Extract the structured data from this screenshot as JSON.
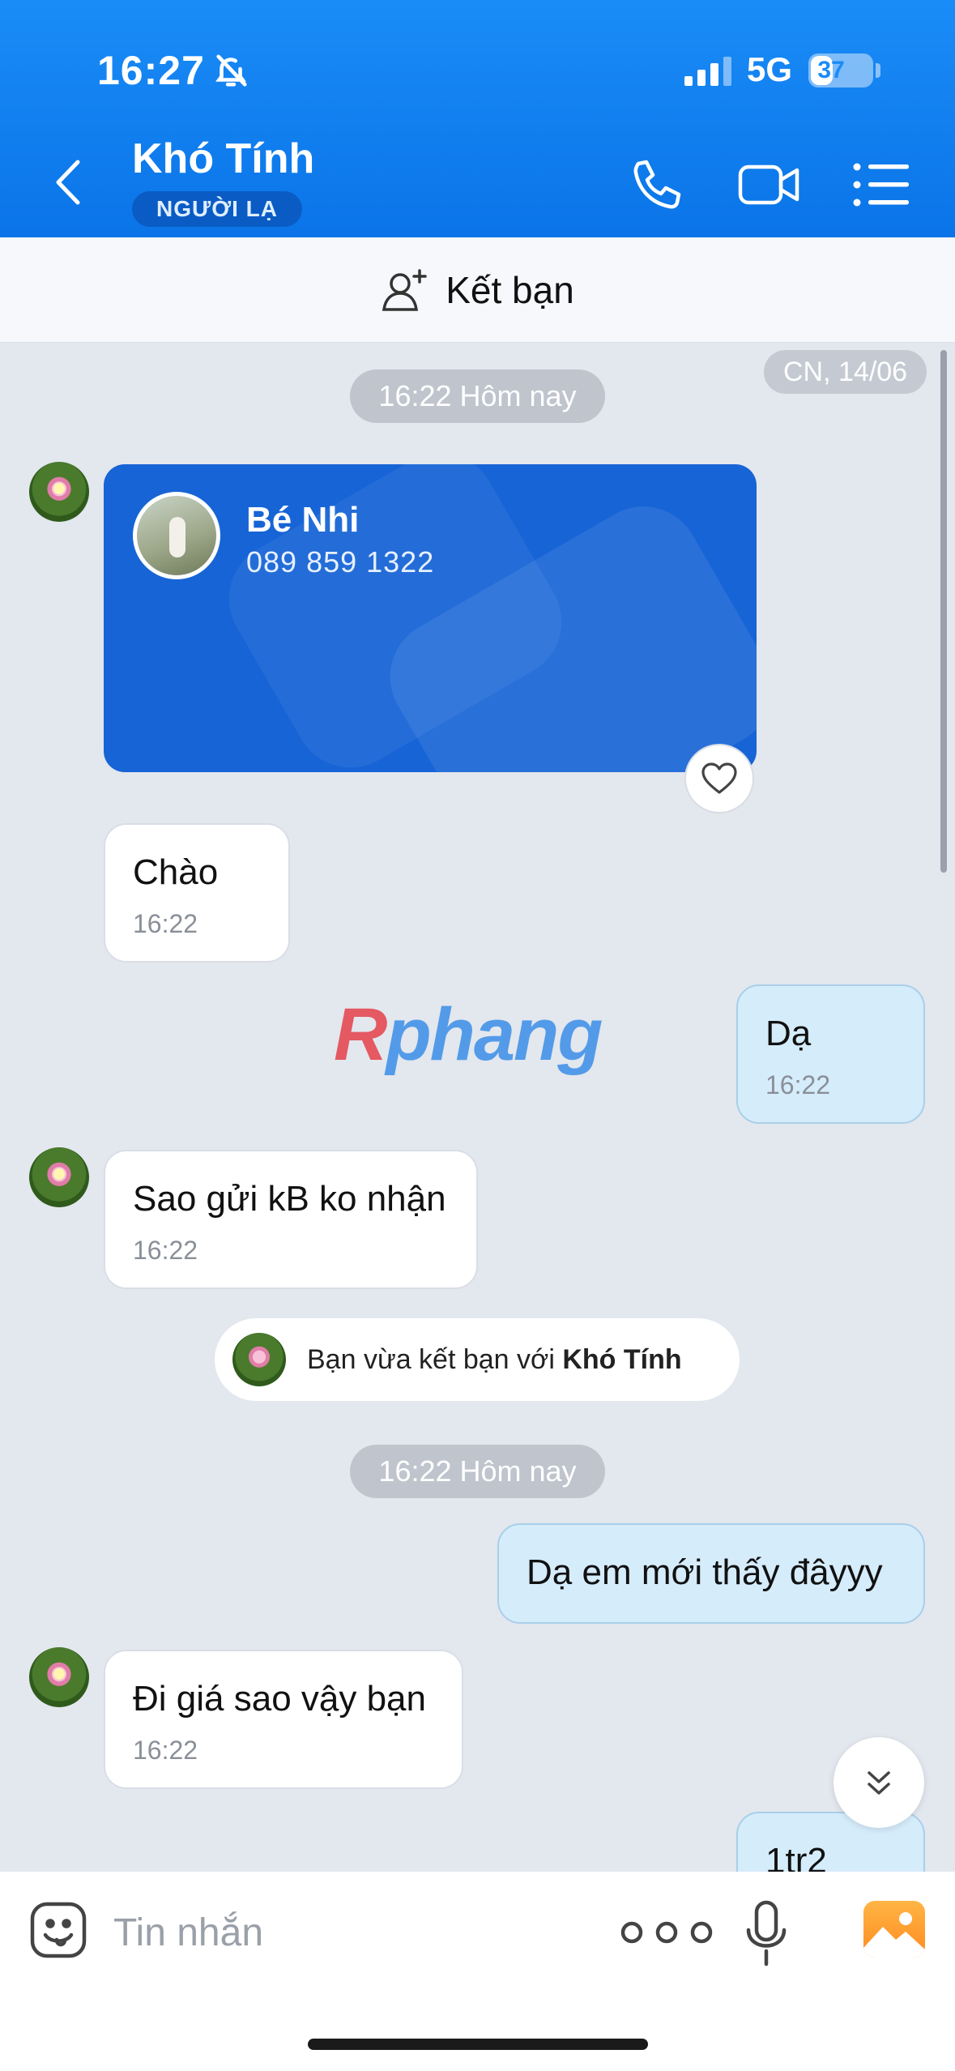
{
  "status_bar": {
    "time": "16:27",
    "network": "5G",
    "battery": "37",
    "battery_level": 0.37
  },
  "header": {
    "title": "Khó Tính",
    "badge": "NGƯỜI LẠ",
    "icons": [
      "back-icon",
      "phone-icon",
      "video-icon",
      "menu-icon"
    ]
  },
  "friend_bar": {
    "label": "Kết bạn",
    "icon": "add-friend-icon"
  },
  "chat": {
    "date_label": "CN, 14/06",
    "time_separators": [
      "16:22 Hôm nay",
      "16:22 Hôm nay"
    ],
    "contact_card": {
      "name": "Bé Nhi",
      "phone": "089 859 1322"
    },
    "messages": [
      {
        "text": "Chào",
        "time": "16:22"
      },
      {
        "text": "Dạ",
        "time": "16:22"
      },
      {
        "text": "Sao gửi kB ko nhận",
        "time": "16:22"
      },
      {
        "text": "Dạ em mới thấy đâyyy"
      },
      {
        "text": "Đi giá sao vậy bạn",
        "time": "16:22"
      },
      {
        "text": "1tr2"
      }
    ],
    "system": {
      "prefix": "Bạn vừa kết bạn với",
      "name": "Khó Tính"
    },
    "watermark": {
      "first": "R",
      "rest": "phang"
    }
  },
  "input": {
    "placeholder": "Tin nhắn"
  },
  "colors": {
    "header": "#0a74e8",
    "card": "#1764d6",
    "outgoing_bubble": "#d5ecfb",
    "chat_background": "#e3e7ee"
  }
}
